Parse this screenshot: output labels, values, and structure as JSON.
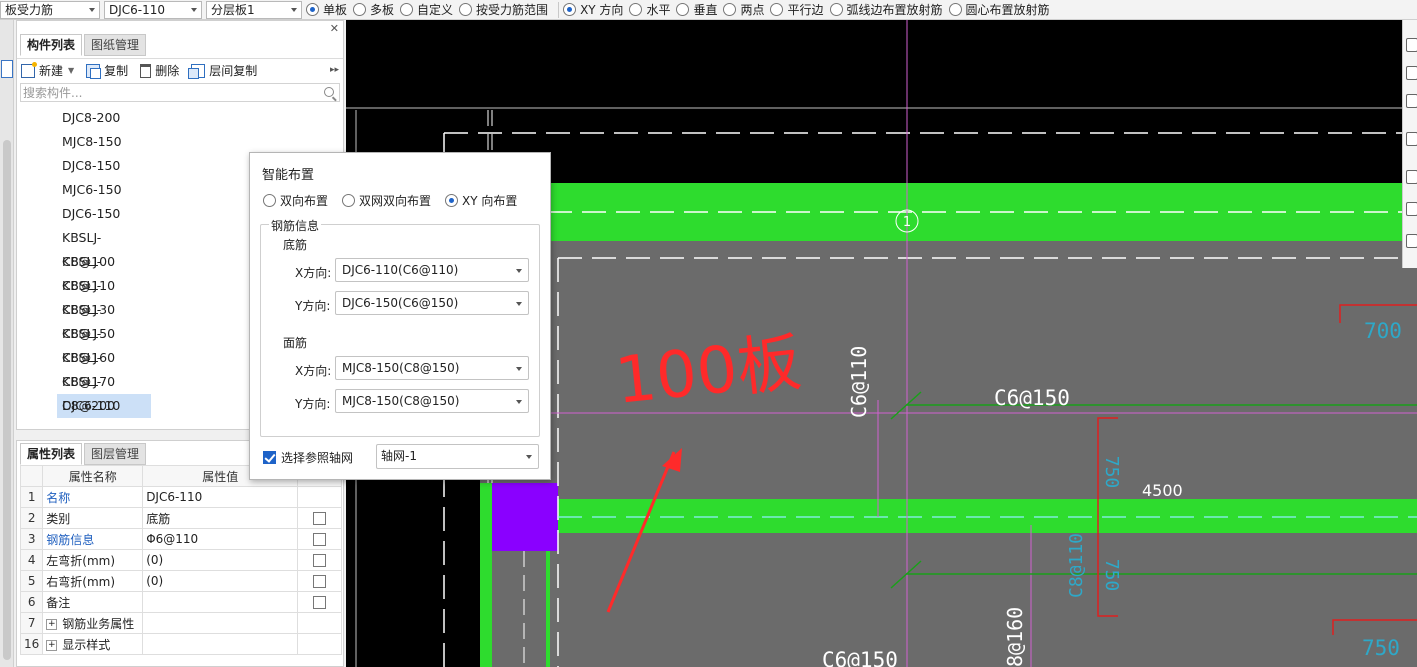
{
  "toolbar": {
    "combo1": "板受力筋",
    "combo2": "DJC6-110",
    "combo3": "分层板1",
    "radios_a": [
      {
        "label": "单板",
        "on": true
      },
      {
        "label": "多板",
        "on": false
      },
      {
        "label": "自定义",
        "on": false
      },
      {
        "label": "按受力筋范围",
        "on": false
      }
    ],
    "radios_b": [
      {
        "label": "XY 方向",
        "on": true
      },
      {
        "label": "水平",
        "on": false
      },
      {
        "label": "垂直",
        "on": false
      },
      {
        "label": "两点",
        "on": false
      },
      {
        "label": "平行边",
        "on": false
      },
      {
        "label": "弧线边布置放射筋",
        "on": false
      },
      {
        "label": "圆心布置放射筋",
        "on": false
      }
    ]
  },
  "component_panel": {
    "tabs": [
      "构件列表",
      "图纸管理"
    ],
    "commands": {
      "new": "新建",
      "copy": "复制",
      "delete": "删除",
      "floor_copy": "层间复制"
    },
    "search_placeholder": "搜索构件...",
    "items": [
      "DJC8-200",
      "MJC8-150",
      "DJC8-150",
      "MJC6-150",
      "DJC6-150",
      "KBSLJ-C8@100",
      "KBSLJ-C8@110",
      "KBSLJ-C8@130",
      "KBSLJ-C8@150",
      "KBSLJ-C8@160",
      "KBSLJ-C8@170",
      "KBSLJ-C8@200",
      "DJC6-110"
    ],
    "selected": "DJC6-110"
  },
  "property_panel": {
    "tabs": [
      "属性列表",
      "图层管理"
    ],
    "col_name": "属性名称",
    "col_value": "属性值",
    "rows": [
      {
        "num": "1",
        "name": "名称",
        "value": "DJC6-110",
        "blue": true,
        "check": false
      },
      {
        "num": "2",
        "name": "类别",
        "value": "底筋",
        "blue": false,
        "check": true
      },
      {
        "num": "3",
        "name": "钢筋信息",
        "value": "Φ6@110",
        "blue": true,
        "check": true
      },
      {
        "num": "4",
        "name": "左弯折(mm)",
        "value": "(0)",
        "blue": false,
        "check": true
      },
      {
        "num": "5",
        "name": "右弯折(mm)",
        "value": "(0)",
        "blue": false,
        "check": true
      },
      {
        "num": "6",
        "name": "备注",
        "value": "",
        "blue": false,
        "check": true
      },
      {
        "num": "7",
        "name": "钢筋业务属性",
        "value": "",
        "blue": false,
        "check": false,
        "expand": true
      },
      {
        "num": "16",
        "name": "显示样式",
        "value": "",
        "blue": false,
        "check": false,
        "expand": true
      }
    ]
  },
  "dialog": {
    "title": "智能布置",
    "modes": [
      {
        "label": "双向布置",
        "on": false
      },
      {
        "label": "双网双向布置",
        "on": false
      },
      {
        "label": "XY 向布置",
        "on": true
      }
    ],
    "group_title": "钢筋信息",
    "bottom_title": "底筋",
    "top_title": "面筋",
    "x_label": "X方向:",
    "y_label": "Y方向:",
    "bottom_x": "DJC6-110(C6@110)",
    "bottom_y": "DJC6-150(C6@150)",
    "top_x": "MJC8-150(C8@150)",
    "top_y": "MJC8-150(C8@150)",
    "axis_check_label": "选择参照轴网",
    "axis_value": "轴网-1"
  },
  "canvas": {
    "axis_label": "1",
    "label_c6_110": "C6@110",
    "label_c6_150": "C6@150",
    "label_c6_150_bottom": "C6@150",
    "label_4500": "4500",
    "label_700": "700",
    "label_750a": "750",
    "label_750b": "750",
    "label_750c": "750",
    "label_8160": "8@160",
    "label_c8_110": "C8@110",
    "annotation": "100板",
    "colors": {
      "slab": "#6b6b6b",
      "beam": "#2edc2e",
      "column": "#8a00ff",
      "dim_red": "#e02020",
      "cyan": "#2ea8c8"
    }
  }
}
